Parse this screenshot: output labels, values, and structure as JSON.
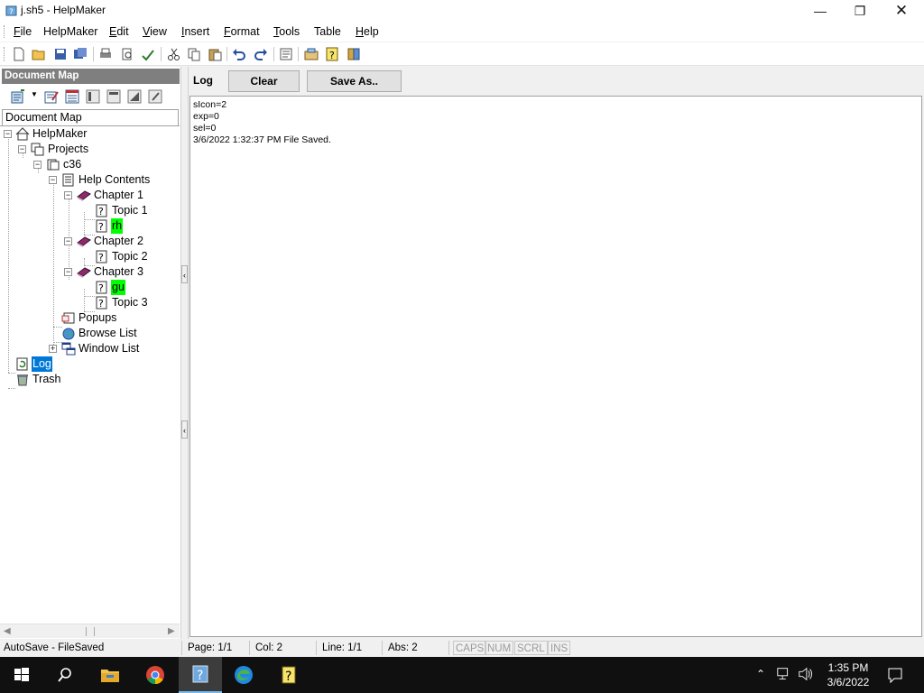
{
  "window": {
    "title": "j.sh5 - HelpMaker"
  },
  "menu": [
    {
      "label": "File",
      "underline": "F",
      "rest": "ile"
    },
    {
      "label": "HelpMaker",
      "underline": "",
      "rest": "HelpMaker"
    },
    {
      "label": "Edit",
      "underline": "E",
      "rest": "dit"
    },
    {
      "label": "View",
      "underline": "V",
      "rest": "iew"
    },
    {
      "label": "Insert",
      "underline": "I",
      "rest": "nsert"
    },
    {
      "label": "Format",
      "underline": "F",
      "rest": "ormat"
    },
    {
      "label": "Tools",
      "underline": "T",
      "rest": "ools"
    },
    {
      "label": "Table",
      "underline": "",
      "rest": "Table"
    },
    {
      "label": "Help",
      "underline": "H",
      "rest": "elp"
    }
  ],
  "toolbar": {
    "icons": [
      "new-icon",
      "open-icon",
      "save-icon",
      "save-all-icon",
      "print-icon",
      "print-preview-icon",
      "spellcheck-icon",
      "cut-icon",
      "copy-icon",
      "paste-icon",
      "undo-icon",
      "redo-icon",
      "properties-icon",
      "compile-icon",
      "help-icon",
      "book-icon"
    ]
  },
  "left_pane": {
    "header": "Document Map",
    "tab_label": "Document Map"
  },
  "tree": {
    "root": "HelpMaker",
    "projects": "Projects",
    "project": "c36",
    "help_contents": "Help Contents",
    "chapter1": "Chapter 1",
    "topic1": "Topic 1",
    "rh": "rh",
    "chapter2": "Chapter 2",
    "topic2": "Topic 2",
    "chapter3": "Chapter 3",
    "gu": "gu",
    "topic3": "Topic 3",
    "popups": "Popups",
    "browse_list": "Browse List",
    "window_list": "Window List",
    "log": "Log",
    "trash": "Trash"
  },
  "log_panel": {
    "title": "Log",
    "clear_label": "Clear",
    "save_as_label": "Save As..",
    "lines": [
      "sIcon=2",
      "exp=0",
      "sel=0",
      "3/6/2022 1:32:37 PM File Saved."
    ]
  },
  "status": {
    "autosave": "AutoSave - FileSaved",
    "page": "Page: 1/1",
    "col": "Col: 2",
    "line": "Line: 1/1",
    "abs": "Abs: 2",
    "caps": "CAPS",
    "num": "NUM",
    "scrl": "SCRL",
    "ins": "INS"
  },
  "taskbar": {
    "time": "1:35 PM",
    "date": "3/6/2022"
  },
  "colors": {
    "highlight_green": "#00ff00",
    "selection_blue": "#0078d7",
    "taskbar_bg": "#101010"
  }
}
